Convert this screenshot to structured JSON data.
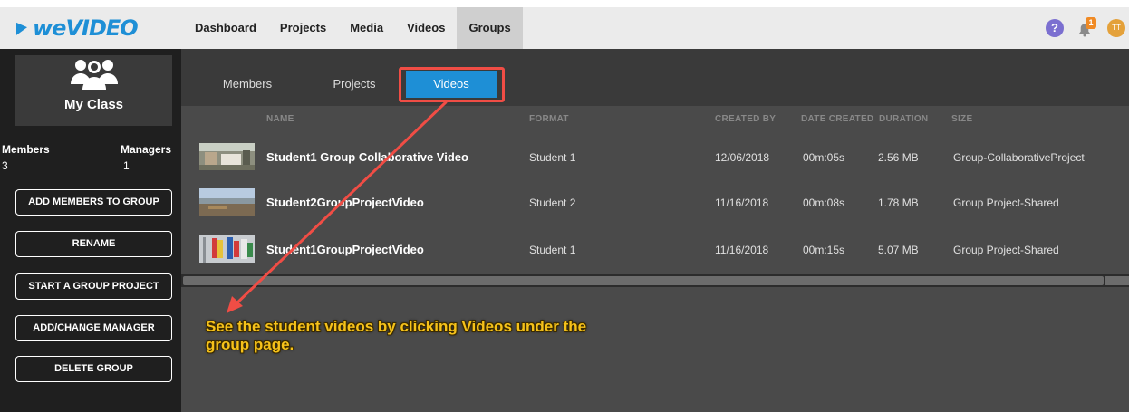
{
  "app": {
    "logo_text": "weVIDEO"
  },
  "nav": {
    "items": [
      {
        "label": "Dashboard"
      },
      {
        "label": "Projects"
      },
      {
        "label": "Media"
      },
      {
        "label": "Videos"
      },
      {
        "label": "Groups"
      }
    ],
    "active": "Groups"
  },
  "top_right": {
    "help_glyph": "?",
    "notification_count": "1",
    "avatar_initials": "TT"
  },
  "sidebar": {
    "group_name": "My Class",
    "members_label": "Members",
    "members_count": "3",
    "managers_label": "Managers",
    "managers_count": "1",
    "buttons": [
      {
        "label": "ADD MEMBERS TO GROUP"
      },
      {
        "label": "RENAME"
      },
      {
        "label": "START A GROUP PROJECT"
      },
      {
        "label": "ADD/CHANGE MANAGER"
      },
      {
        "label": "DELETE GROUP"
      }
    ]
  },
  "tabs": [
    {
      "label": "Members"
    },
    {
      "label": "Projects"
    },
    {
      "label": "Videos"
    }
  ],
  "active_tab": "Videos",
  "table": {
    "columns": [
      "NAME",
      "FORMAT",
      "CREATED BY",
      "DATE CREATED",
      "DURATION",
      "SIZE"
    ],
    "rows": [
      {
        "name": "Student1 Group Collaborative Video",
        "created_by": "Student 1",
        "date_created": "12/06/2018",
        "duration": "00m:05s",
        "size": "2.56 MB",
        "project": "Group-CollaborativeProject"
      },
      {
        "name": "Student2GroupProjectVideo",
        "created_by": "Student 2",
        "date_created": "11/16/2018",
        "duration": "00m:08s",
        "size": "1.78 MB",
        "project": "Group Project-Shared"
      },
      {
        "name": "Student1GroupProjectVideo",
        "created_by": "Student 1",
        "date_created": "11/16/2018",
        "duration": "00m:15s",
        "size": "5.07 MB",
        "project": "Group Project-Shared"
      }
    ]
  },
  "annotation": {
    "text": "See the student videos by clicking Videos under the group page."
  },
  "colors": {
    "accent": "#1e8fd6",
    "callout_red": "#f04d45",
    "annotation_yellow": "#f6c21a",
    "badge_orange": "#f08a24"
  }
}
